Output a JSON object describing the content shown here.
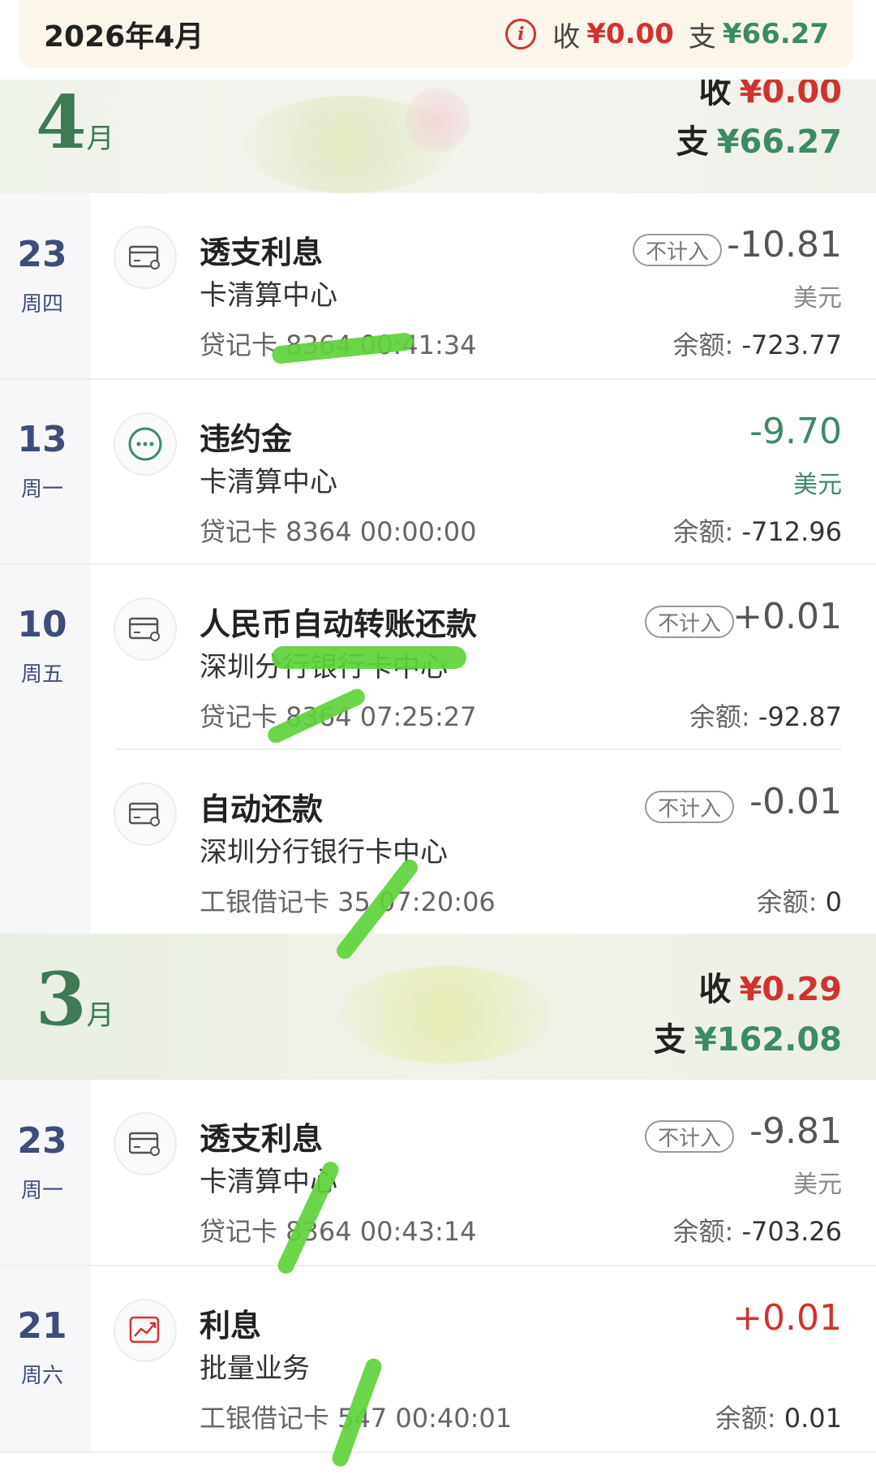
{
  "header": {
    "title": "2026年4月",
    "income_label": "收",
    "income_value": "¥0.00",
    "expense_label": "支",
    "expense_value": "¥66.27"
  },
  "months": [
    {
      "month": "4",
      "unit": "月",
      "income_label": "收",
      "income_value": "¥0.00",
      "expense_label": "支",
      "expense_value": "¥66.27"
    },
    {
      "month": "3",
      "unit": "月",
      "income_label": "收",
      "income_value": "¥0.29",
      "expense_label": "支",
      "expense_value": "¥162.08"
    }
  ],
  "transactions": [
    {
      "day": "23",
      "weekday": "周四",
      "title": "透支利息",
      "sub": "卡清算中心",
      "meta": "贷记卡 8364 00:41:34",
      "badge": "不计入",
      "amount": "-10.81",
      "currency": "美元",
      "balance_label": "余额:",
      "balance": "-723.77",
      "icon": "credit-card-icon"
    },
    {
      "day": "13",
      "weekday": "周一",
      "title": "违约金",
      "sub": "卡清算中心",
      "meta": "贷记卡 8364 00:00:00",
      "badge": "",
      "amount": "-9.70",
      "currency": "美元",
      "balance_label": "余额:",
      "balance": "-712.96",
      "icon": "more-dots-icon"
    },
    {
      "day": "10",
      "weekday": "周五",
      "title": "人民币自动转账还款",
      "sub": "深圳分行银行卡中心",
      "meta": "贷记卡 8364 07:25:27",
      "badge": "不计入",
      "amount": "+0.01",
      "currency": "",
      "balance_label": "余额:",
      "balance": "-92.87",
      "icon": "credit-card-icon"
    },
    {
      "day": "",
      "weekday": "",
      "title": "自动还款",
      "sub": "深圳分行银行卡中心",
      "meta": "工银借记卡 35 07:20:06",
      "badge": "不计入",
      "amount": "-0.01",
      "currency": "",
      "balance_label": "余额:",
      "balance": "0",
      "icon": "credit-card-icon"
    },
    {
      "day": "23",
      "weekday": "周一",
      "title": "透支利息",
      "sub": "卡清算中心",
      "meta": "贷记卡 8364 00:43:14",
      "badge": "不计入",
      "amount": "-9.81",
      "currency": "美元",
      "balance_label": "余额:",
      "balance": "-703.26",
      "icon": "credit-card-icon"
    },
    {
      "day": "21",
      "weekday": "周六",
      "title": "利息",
      "sub": "批量业务",
      "meta": "工银借记卡 547 00:40:01",
      "badge": "",
      "amount": "+0.01",
      "currency": "",
      "balance_label": "余额:",
      "balance": "0.01",
      "icon": "trend-chart-icon"
    }
  ],
  "colors": {
    "income": "#d0332e",
    "expense": "#3d8a66",
    "date_text": "#3f4d7a",
    "scribble": "#5ed33a"
  }
}
